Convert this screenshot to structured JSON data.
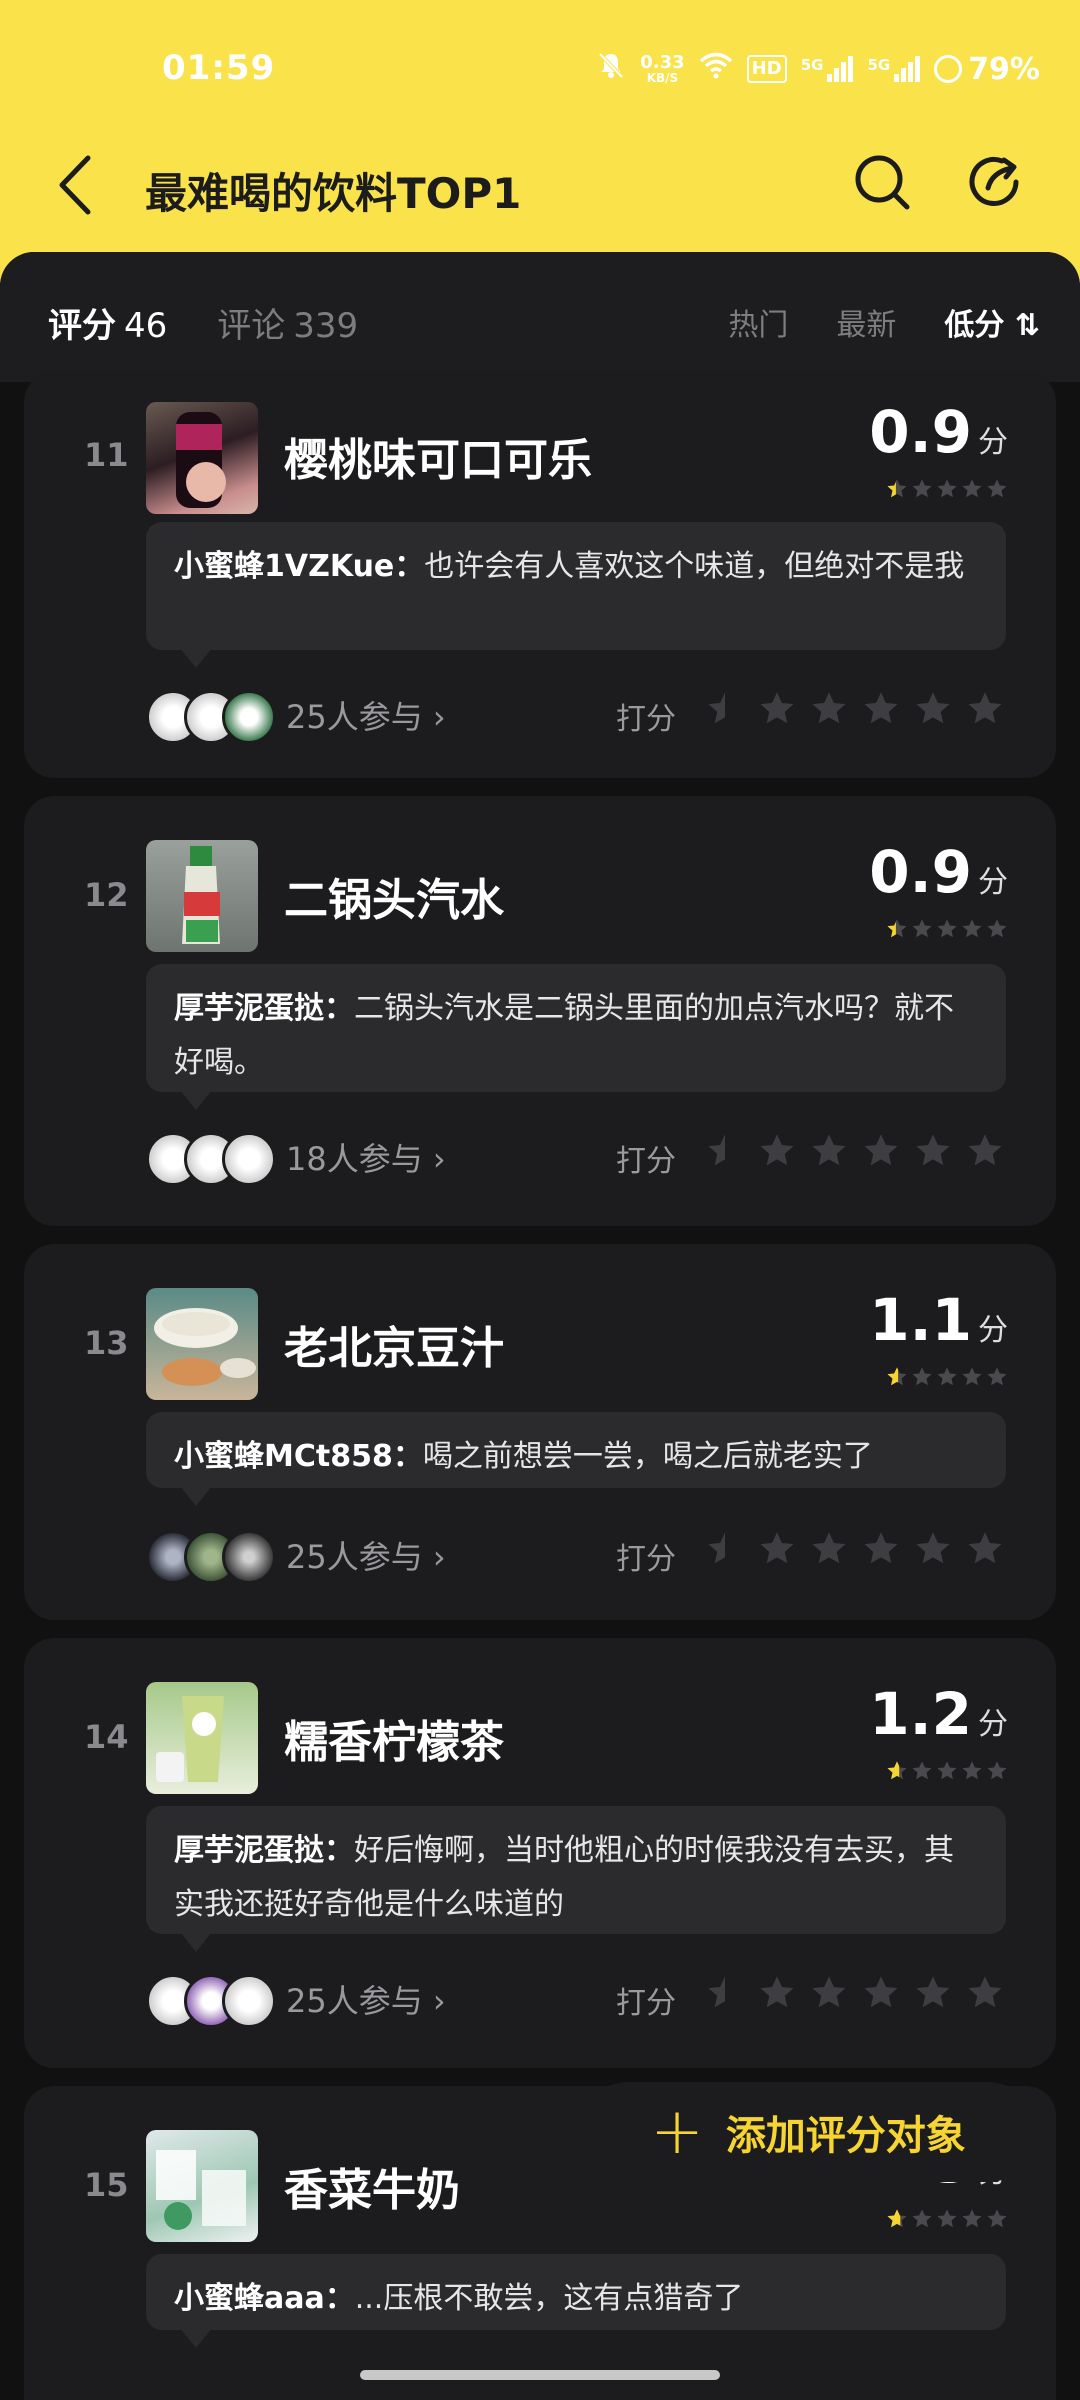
{
  "status_bar": {
    "time": "01:59",
    "net_speed_value": "0.33",
    "net_speed_unit": "KB/S",
    "hd_label": "HD",
    "sim1_label": "5G",
    "sim2_label": "5G",
    "battery": "79%"
  },
  "header": {
    "title": "最难喝的饮料TOP1"
  },
  "tabs": {
    "rating_label": "评分",
    "rating_count": "46",
    "comment_label": "评论",
    "comment_count": "339",
    "sort_hot": "热门",
    "sort_new": "最新",
    "sort_low": "低分 ⇅"
  },
  "rate_label": "打分",
  "items": [
    {
      "rank": "11",
      "name": "樱桃味可口可乐",
      "score": "0.9",
      "unit": "分",
      "comment_user": "小蜜蜂1VZKue：",
      "comment_text": "也许会有人喜欢这个味道，但绝对不是我",
      "participants": "25人参与 ›"
    },
    {
      "rank": "12",
      "name": "二锅头汽水",
      "score": "0.9",
      "unit": "分",
      "comment_user": "厚芋泥蛋挞：",
      "comment_text": "二锅头汽水是二锅头里面的加点汽水吗？就不好喝。",
      "participants": "18人参与 ›"
    },
    {
      "rank": "13",
      "name": "老北京豆汁",
      "score": "1.1",
      "unit": "分",
      "comment_user": "小蜜蜂MCt858：",
      "comment_text": "喝之前想尝一尝，喝之后就老实了",
      "participants": "25人参与 ›"
    },
    {
      "rank": "14",
      "name": "糯香柠檬茶",
      "score": "1.2",
      "unit": "分",
      "comment_user": "厚芋泥蛋挞：",
      "comment_text": "好后悔啊，当时他粗心的时候我没有去买，其实我还挺好奇他是什么味道的",
      "participants": "25人参与 ›"
    },
    {
      "rank": "15",
      "name": "香菜牛奶",
      "score": "1.3",
      "unit": "分",
      "comment_user": "小蜜蜂aaa：",
      "comment_text": "...压根不敢尝，这有点猎奇了",
      "participants": ""
    }
  ],
  "add_button": {
    "label": "添加评分对象"
  }
}
